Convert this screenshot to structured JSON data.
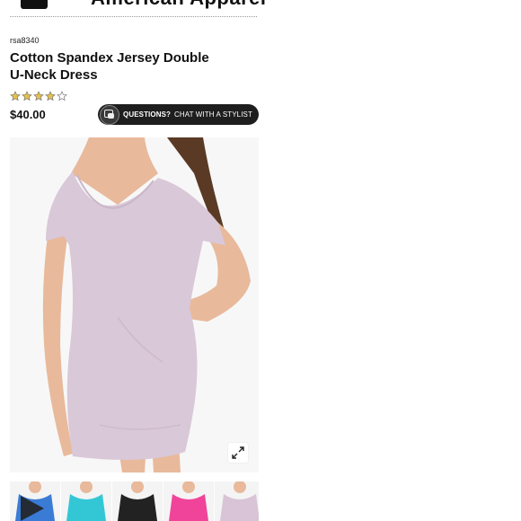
{
  "header": {
    "menu_icon": "hamburger-menu-icon",
    "brand": "American Apparel"
  },
  "product": {
    "sku": "rsa8340",
    "title": "Cotton Spandex Jersey Double U-Neck Dress",
    "rating": 4,
    "rating_max": 5,
    "price": "$40.00"
  },
  "chat": {
    "label_bold": "QUESTIONS?",
    "label": "CHAT WITH A STYLIST",
    "icon": "chat-bubbles-icon"
  },
  "gallery": {
    "expand_icon": "expand-arrows-icon",
    "thumbnails": [
      {
        "color": "#3a7bd5",
        "video": true
      },
      {
        "color": "#33c7d6",
        "video": false
      },
      {
        "color": "#222222",
        "video": false
      },
      {
        "color": "#f0449a",
        "video": false
      },
      {
        "color": "#d8c4d6",
        "video": false
      }
    ]
  },
  "colors": {
    "dress": "#d9c8d8",
    "skin": "#e8b99b",
    "hair": "#5a3a24"
  }
}
